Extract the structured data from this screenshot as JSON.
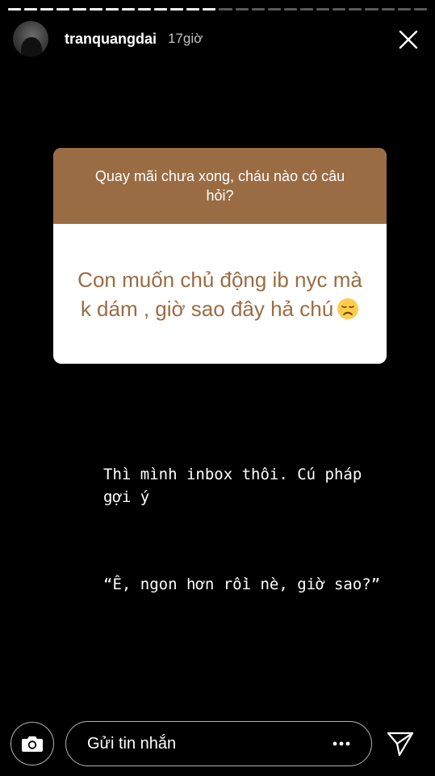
{
  "header": {
    "username": "tranquangdai",
    "time": "17giờ"
  },
  "progress": {
    "segments_total": 26,
    "segments_done": 13
  },
  "question": {
    "prompt": "Quay mãi chưa xong, cháu nào có câu hỏi?",
    "answer": "Con muốn chủ động ib nyc mà k dám , giờ sao đây hả chú",
    "emoji": "disappointed-face"
  },
  "reply": {
    "line1": "Thì mình inbox thôi. Cú pháp gợi ý",
    "line2": "“Ê, ngon hơn rồi nè, giờ sao?”"
  },
  "composer": {
    "placeholder": "Gửi tin nhắn"
  },
  "colors": {
    "card_accent": "#9a6c44",
    "background": "#000000"
  }
}
